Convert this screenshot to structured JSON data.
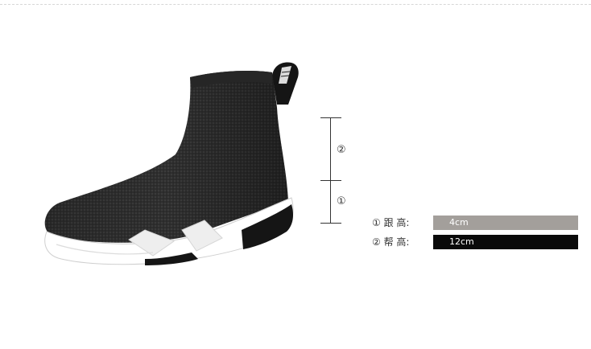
{
  "scale": {
    "marker_top": "②",
    "marker_bottom": "①"
  },
  "legend": [
    {
      "label": "① 跟   高:",
      "value": "4cm",
      "bar_color": "#a39f9b",
      "text_color": "#ffffff"
    },
    {
      "label": "② 帮   高:",
      "value": "12cm",
      "bar_color": "#0a0a0a",
      "text_color": "#ffffff"
    }
  ]
}
